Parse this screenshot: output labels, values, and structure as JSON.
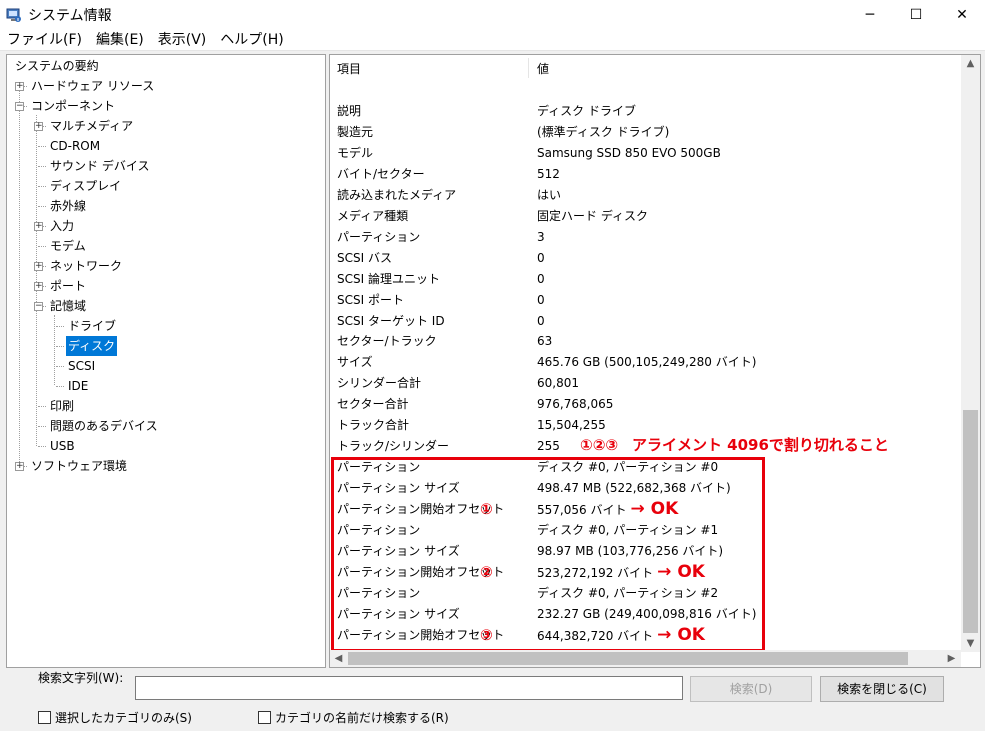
{
  "window": {
    "title": "システム情報",
    "controls": {
      "minimize": "─",
      "maximize": "☐",
      "close": "✕"
    }
  },
  "menu": [
    "ファイル(F)",
    "編集(E)",
    "表示(V)",
    "ヘルプ(H)"
  ],
  "tree": [
    {
      "label": "システムの要約",
      "level": 0,
      "expander": ""
    },
    {
      "label": "ハードウェア リソース",
      "level": 1,
      "expander": "+"
    },
    {
      "label": "コンポーネント",
      "level": 1,
      "expander": "-"
    },
    {
      "label": "マルチメディア",
      "level": 2,
      "expander": "+"
    },
    {
      "label": "CD-ROM",
      "level": 2,
      "expander": ""
    },
    {
      "label": "サウンド デバイス",
      "level": 2,
      "expander": ""
    },
    {
      "label": "ディスプレイ",
      "level": 2,
      "expander": ""
    },
    {
      "label": "赤外線",
      "level": 2,
      "expander": ""
    },
    {
      "label": "入力",
      "level": 2,
      "expander": "+"
    },
    {
      "label": "モデム",
      "level": 2,
      "expander": ""
    },
    {
      "label": "ネットワーク",
      "level": 2,
      "expander": "+"
    },
    {
      "label": "ポート",
      "level": 2,
      "expander": "+"
    },
    {
      "label": "記憶域",
      "level": 2,
      "expander": "-"
    },
    {
      "label": "ドライブ",
      "level": 3,
      "expander": ""
    },
    {
      "label": "ディスク",
      "level": 3,
      "expander": "",
      "selected": true
    },
    {
      "label": "SCSI",
      "level": 3,
      "expander": ""
    },
    {
      "label": "IDE",
      "level": 3,
      "expander": ""
    },
    {
      "label": "印刷",
      "level": 2,
      "expander": ""
    },
    {
      "label": "問題のあるデバイス",
      "level": 2,
      "expander": ""
    },
    {
      "label": "USB",
      "level": 2,
      "expander": ""
    },
    {
      "label": "ソフトウェア環境",
      "level": 1,
      "expander": "+"
    }
  ],
  "list": {
    "columns": {
      "item": "項目",
      "value": "値"
    },
    "rows": [
      {
        "k": "説明",
        "v": "ディスク ドライブ"
      },
      {
        "k": "製造元",
        "v": "(標準ディスク ドライブ)"
      },
      {
        "k": "モデル",
        "v": "Samsung SSD 850 EVO 500GB"
      },
      {
        "k": "バイト/セクター",
        "v": "512"
      },
      {
        "k": "読み込まれたメディア",
        "v": "はい"
      },
      {
        "k": "メディア種類",
        "v": "固定ハード ディスク"
      },
      {
        "k": "パーティション",
        "v": "3"
      },
      {
        "k": "SCSI バス",
        "v": "0"
      },
      {
        "k": "SCSI 論理ユニット",
        "v": "0"
      },
      {
        "k": "SCSI ポート",
        "v": "0"
      },
      {
        "k": "SCSI ターゲット ID",
        "v": "0"
      },
      {
        "k": "セクター/トラック",
        "v": "63"
      },
      {
        "k": "サイズ",
        "v": "465.76 GB (500,105,249,280 バイト)"
      },
      {
        "k": "シリンダー合計",
        "v": "60,801"
      },
      {
        "k": "セクター合計",
        "v": "976,768,065"
      },
      {
        "k": "トラック合計",
        "v": "15,504,255"
      },
      {
        "k": "トラック/シリンダー",
        "v": "255"
      },
      {
        "k": "パーティション",
        "v": "ディスク #0, パーティション #0"
      },
      {
        "k": "パーティション サイズ",
        "v": "498.47 MB (522,682,368 バイト)"
      },
      {
        "k": "パーティション開始オフセット",
        "v": "557,056 バイト",
        "mark": "①",
        "ok": "→ OK"
      },
      {
        "k": "パーティション",
        "v": "ディスク #0, パーティション #1"
      },
      {
        "k": "パーティション サイズ",
        "v": "98.97 MB (103,776,256 バイト)"
      },
      {
        "k": "パーティション開始オフセット",
        "v": "523,272,192 バイト",
        "mark": "②",
        "ok": "→ OK"
      },
      {
        "k": "パーティション",
        "v": "ディスク #0, パーティション #2"
      },
      {
        "k": "パーティション サイズ",
        "v": "232.27 GB (249,400,098,816 バイト)"
      },
      {
        "k": "パーティション開始オフセット",
        "v": "644,382,720 バイト",
        "mark": "③",
        "ok": "→ OK"
      }
    ]
  },
  "annotation": {
    "marks": "①②③",
    "text": "アライメント 4096で割り切れること"
  },
  "search": {
    "label": "検索文字列(W):",
    "value": "",
    "find_button": "検索(D)",
    "close_button": "検索を閉じる(C)",
    "option_selected_only": "選択したカテゴリのみ(S)",
    "option_names_only": "カテゴリの名前だけ検索する(R)"
  },
  "colors": {
    "selection": "#0078d7",
    "annotation_red": "#e8000b"
  }
}
